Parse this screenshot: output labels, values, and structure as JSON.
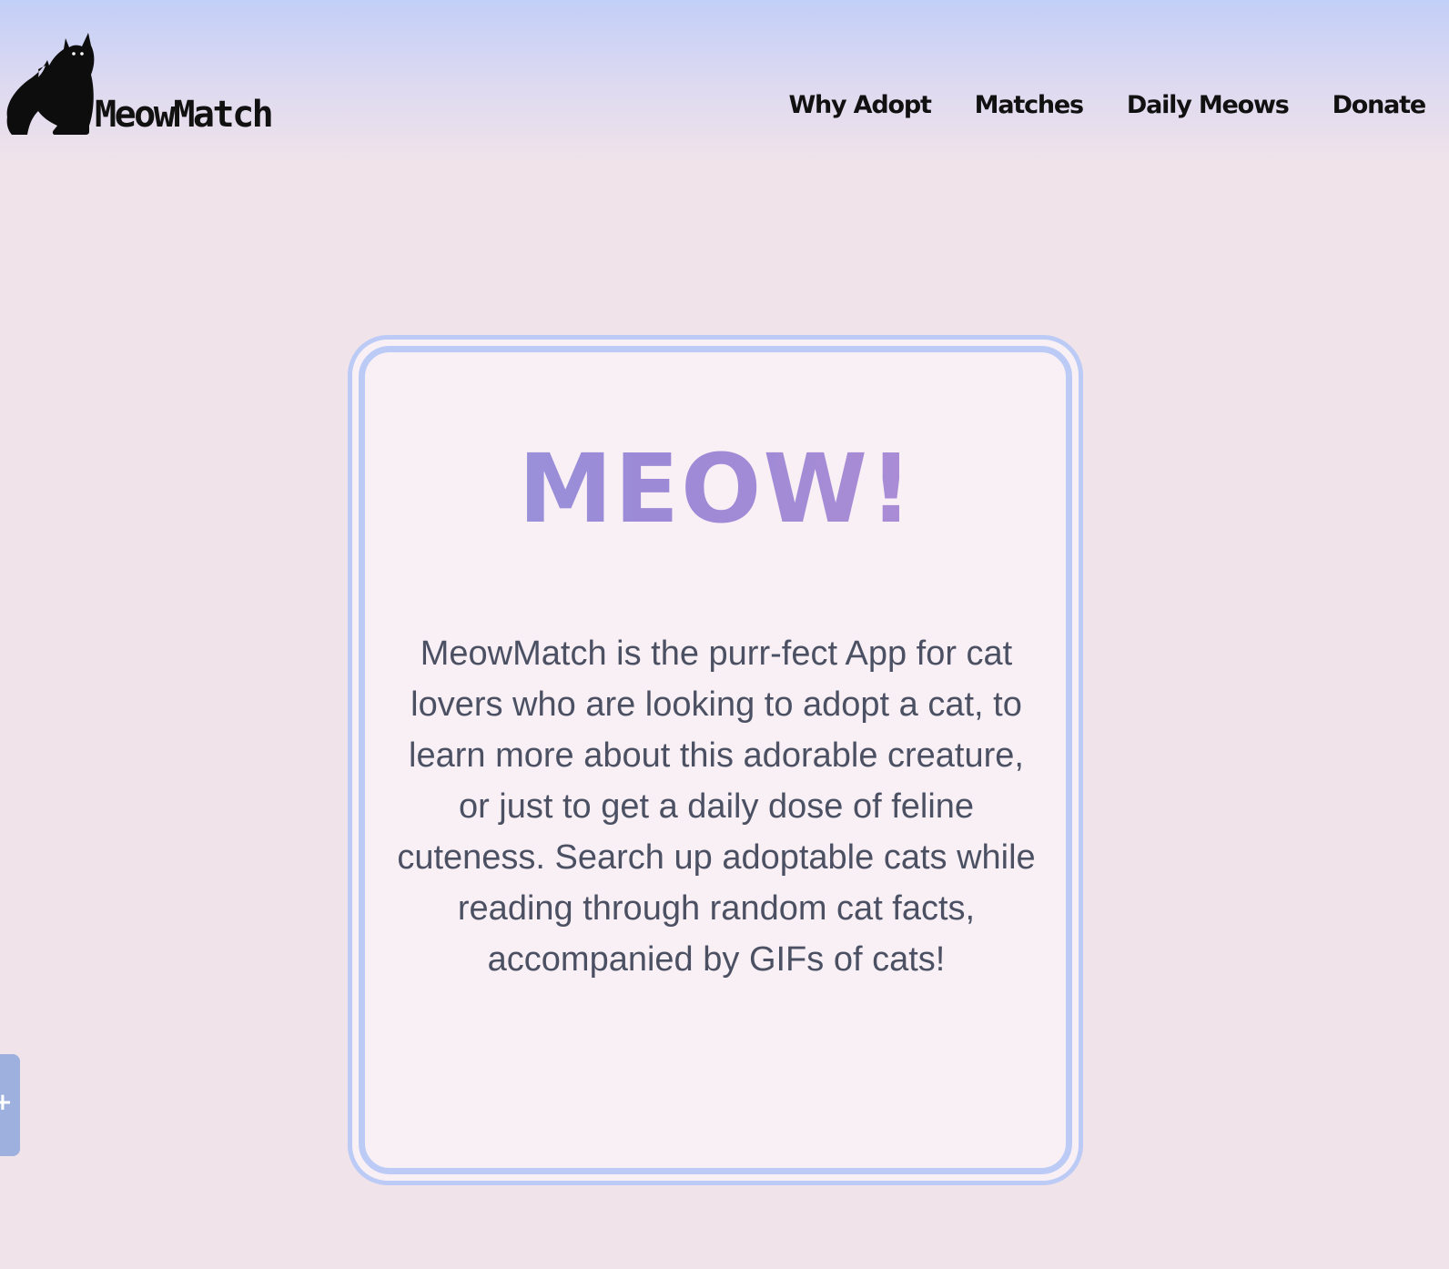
{
  "brand": {
    "name": "MeowMatch",
    "logo_icon": "cat-silhouette-icon"
  },
  "nav": {
    "items": [
      {
        "label": "Why Adopt"
      },
      {
        "label": "Matches"
      },
      {
        "label": "Daily Meows"
      },
      {
        "label": "Donate"
      }
    ]
  },
  "hero": {
    "headline": "MEOW!",
    "description": "MeowMatch is the purr-fect App for cat lovers who are looking to adopt a cat, to learn more about this adorable creature, or just to get a daily dose of feline cuteness. Search up adoptable cats while reading through random cat facts, accompanied by GIFs of cats!"
  },
  "side_tab": {
    "icon": "plus-icon",
    "glyph": "+"
  },
  "colors": {
    "header_top": "#c2cff7",
    "background": "#f0e3ea",
    "card_background": "#f9f0f6",
    "card_border": "#bccbf6",
    "headline_gradient_start": "#8fa9e6",
    "headline_gradient_mid": "#9c8ad6",
    "headline_gradient_end": "#c490d3",
    "body_text": "#4b5163",
    "side_tab": "#9db0de"
  }
}
